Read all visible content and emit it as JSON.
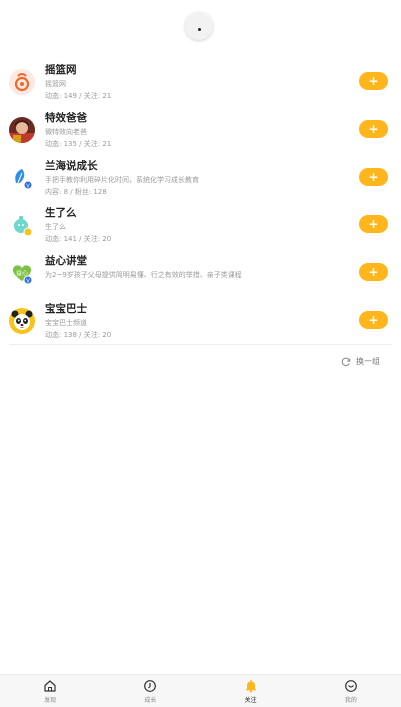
{
  "accent_color": "#ffb61d",
  "follow_button_label": "+",
  "accounts": [
    {
      "name": "摇篮网",
      "desc": "摇篮网",
      "stats": "动态: 149 / 关注: 21",
      "avatar_icon": "yaolan-logo-icon"
    },
    {
      "name": "特效爸爸",
      "desc": "微特效向老爸",
      "stats": "动态: 135 / 关注: 21",
      "avatar_icon": "person-photo-icon"
    },
    {
      "name": "兰海说成长",
      "desc": "手把手教你利用碎片化时间，系统化学习成长教育",
      "stats": "内容: 8 / 粉丝: 128",
      "avatar_icon": "blue-leaf-icon"
    },
    {
      "name": "生了么",
      "desc": "生了么",
      "stats": "动态: 141 / 关注: 20",
      "avatar_icon": "baby-bottle-icon"
    },
    {
      "name": "益心讲堂",
      "desc": "为2~9岁孩子父母提供简明易懂、行之有效的举措、亲子类课程",
      "stats": "",
      "avatar_icon": "green-heart-icon"
    },
    {
      "name": "宝宝巴士",
      "desc": "宝宝巴士频道",
      "stats": "动态: 138 / 关注: 20",
      "avatar_icon": "panda-icon"
    }
  ],
  "refresh_label": "换一组",
  "tabs": [
    {
      "label": "发现",
      "icon": "home-icon",
      "active": false
    },
    {
      "label": "成长",
      "icon": "clock-icon",
      "active": false
    },
    {
      "label": "关注",
      "icon": "bell-icon",
      "active": true
    },
    {
      "label": "我的",
      "icon": "smile-icon",
      "active": false
    }
  ]
}
